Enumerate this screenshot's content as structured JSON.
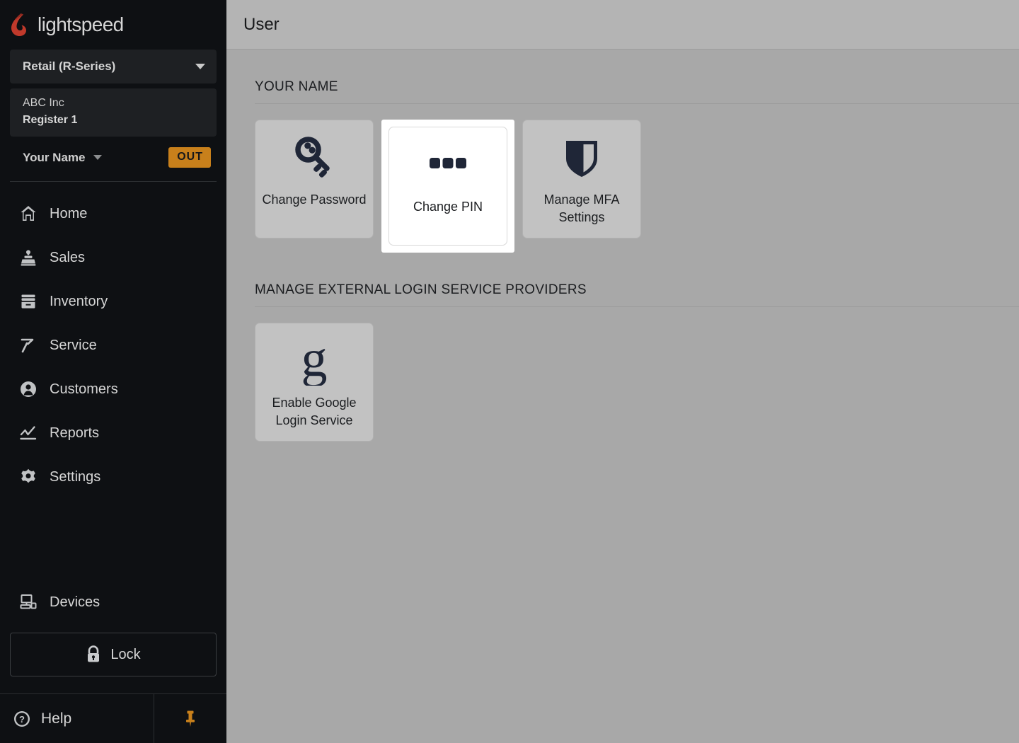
{
  "colors": {
    "sidebar_bg": "#0e1013",
    "panel_bg": "#1e2023",
    "accent_orange": "#c8801b",
    "brand_red": "#c0392b",
    "content_bg": "#a8a8a8",
    "topbar_bg": "#b4b4b4",
    "tile_bg": "#c2c2c2",
    "tile_selected_bg": "#ffffff",
    "icon_navy": "#1f2637"
  },
  "sidebar": {
    "brand": {
      "name": "lightspeed",
      "logo_icon": "lightspeed-flame-logo"
    },
    "series_select": {
      "value": "Retail (R-Series)",
      "caret_icon": "chevron-down-icon"
    },
    "store": {
      "company": "ABC Inc",
      "register": "Register 1"
    },
    "user": {
      "name": "Your Name",
      "caret_icon": "chevron-down-icon",
      "status_badge": "OUT"
    },
    "nav_items": [
      {
        "label": "Home",
        "icon": "home-icon"
      },
      {
        "label": "Sales",
        "icon": "sales-register-icon"
      },
      {
        "label": "Inventory",
        "icon": "inventory-box-icon"
      },
      {
        "label": "Service",
        "icon": "hammer-wrench-icon"
      },
      {
        "label": "Customers",
        "icon": "user-circle-icon"
      },
      {
        "label": "Reports",
        "icon": "chart-line-icon"
      },
      {
        "label": "Settings",
        "icon": "gear-icon"
      }
    ],
    "devices": {
      "label": "Devices",
      "icon": "desktop-computer-icon"
    },
    "lock_button": {
      "label": "Lock",
      "icon": "padlock-icon"
    },
    "help": {
      "label": "Help",
      "icon": "question-circle-icon"
    },
    "pin_button": {
      "icon": "pushpin-icon"
    }
  },
  "topbar": {
    "title": "User"
  },
  "sections": [
    {
      "heading": "YOUR NAME",
      "tiles": [
        {
          "label": "Change Password",
          "icon": "skeleton-key-icon",
          "selected": false
        },
        {
          "label": "Change PIN",
          "icon": "three-dots-pin-icon",
          "selected": true
        },
        {
          "label": "Manage MFA Settings",
          "icon": "shield-icon",
          "selected": false
        }
      ]
    },
    {
      "heading": "MANAGE EXTERNAL LOGIN SERVICE PROVIDERS",
      "tiles": [
        {
          "label": "Enable Google Login Service",
          "icon": "google-g-icon",
          "selected": false
        }
      ]
    }
  ]
}
